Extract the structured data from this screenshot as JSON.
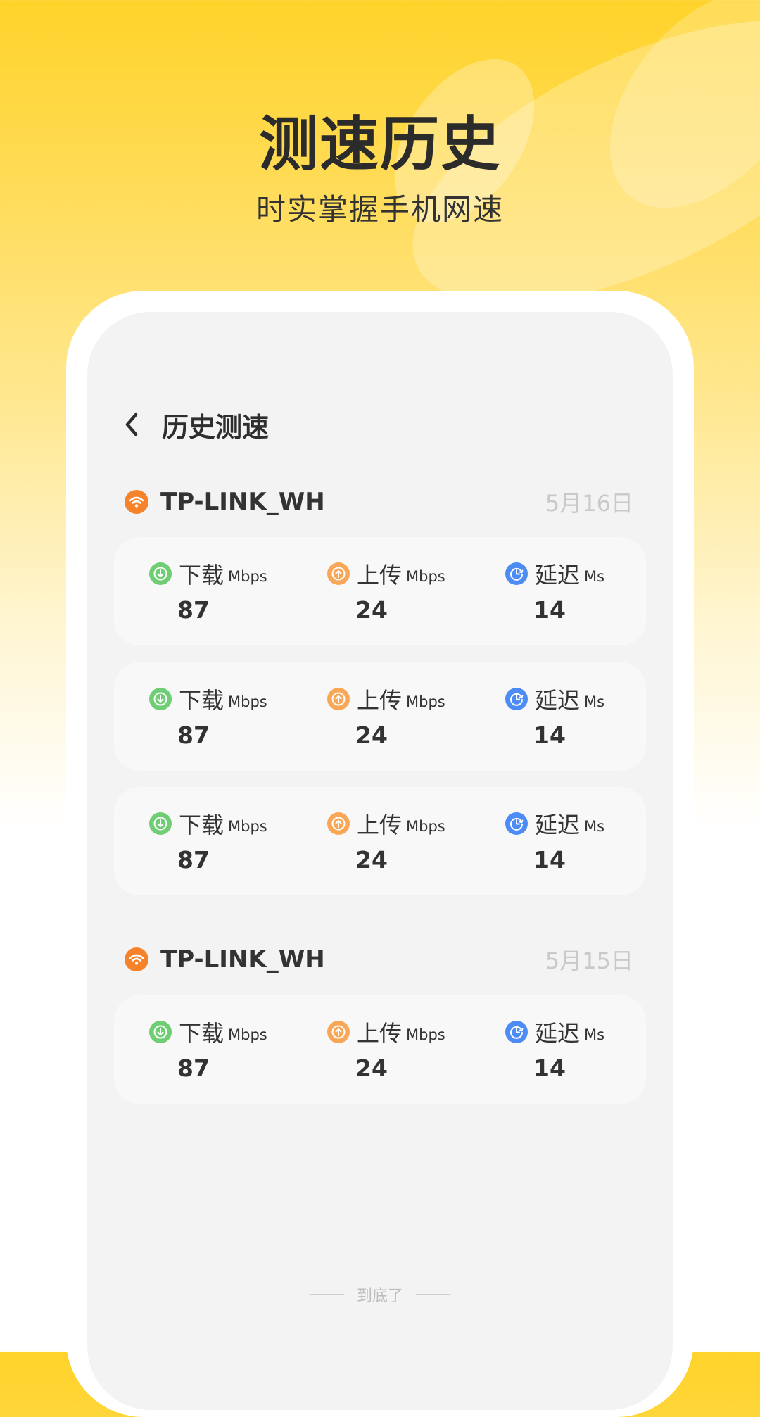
{
  "hero": {
    "title": "测速历史",
    "subtitle": "时实掌握手机网速"
  },
  "nav": {
    "back_icon": "chevron-left-icon",
    "title": "历史测速"
  },
  "groups": [
    {
      "ssid": "TP-LINK_WH",
      "date": "5月16日",
      "records": [
        {
          "download": {
            "label": "下载",
            "unit": "Mbps",
            "value": "87"
          },
          "upload": {
            "label": "上传",
            "unit": "Mbps",
            "value": "24"
          },
          "latency": {
            "label": "延迟",
            "unit": "Ms",
            "value": "14"
          }
        },
        {
          "download": {
            "label": "下载",
            "unit": "Mbps",
            "value": "87"
          },
          "upload": {
            "label": "上传",
            "unit": "Mbps",
            "value": "24"
          },
          "latency": {
            "label": "延迟",
            "unit": "Ms",
            "value": "14"
          }
        },
        {
          "download": {
            "label": "下载",
            "unit": "Mbps",
            "value": "87"
          },
          "upload": {
            "label": "上传",
            "unit": "Mbps",
            "value": "24"
          },
          "latency": {
            "label": "延迟",
            "unit": "Ms",
            "value": "14"
          }
        }
      ]
    },
    {
      "ssid": "TP-LINK_WH",
      "date": "5月15日",
      "records": [
        {
          "download": {
            "label": "下载",
            "unit": "Mbps",
            "value": "87"
          },
          "upload": {
            "label": "上传",
            "unit": "Mbps",
            "value": "24"
          },
          "latency": {
            "label": "延迟",
            "unit": "Ms",
            "value": "14"
          }
        }
      ]
    }
  ],
  "footer": {
    "end_text": "到底了"
  },
  "colors": {
    "brand_yellow": "#FFD32A",
    "wifi_orange": "#F6832A",
    "download_green": "#6FCD74",
    "upload_orange": "#F9A756",
    "latency_blue": "#4D8CF5"
  }
}
